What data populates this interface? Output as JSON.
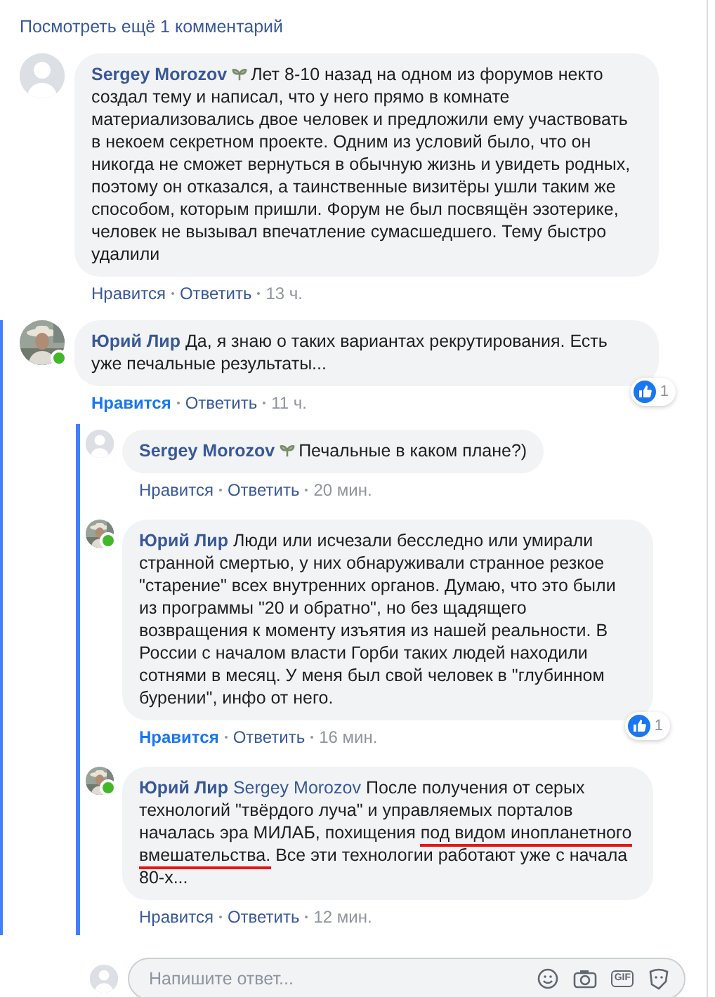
{
  "more_link": "Посмотреть ещё 1 комментарий",
  "comments": [
    {
      "author": "Sergey Morozov",
      "badge": true,
      "photo": false,
      "online": false,
      "segments": [
        {
          "kind": "plain",
          "text": "Лет 8-10 назад на одном из форумов некто создал тему и написал, что у него прямо в комнате материализовались двое человек и предложили ему участвовать в некоем секретном проекте. Одним из условий было, что он никогда не сможет вернуться в обычную жизнь и увидеть родных, поэтому он отказался, а таинственные визитёры ушли таким же способом, которым пришли. Форум не был посвящён эзотерике, человек не вызывал впечатление сумасшедшего. Тему быстро удалили"
        }
      ],
      "like": "Нравится",
      "liked": false,
      "reply": "Ответить",
      "time": "13 ч."
    },
    {
      "author": "Юрий Лир",
      "badge": false,
      "photo": true,
      "online": true,
      "segments": [
        {
          "kind": "plain",
          "text": "Да, я знаю о таких вариантах рекрутирования. Есть уже печальные результаты..."
        }
      ],
      "like": "Нравится",
      "liked": true,
      "reply": "Ответить",
      "time": "11 ч.",
      "reactions": "1",
      "children": [
        {
          "author": "Sergey Morozov",
          "badge": true,
          "photo": false,
          "online": false,
          "segments": [
            {
              "kind": "plain",
              "text": "Печальные в каком плане?)"
            }
          ],
          "like": "Нравится",
          "liked": false,
          "reply": "Ответить",
          "time": "20 мин."
        },
        {
          "author": "Юрий Лир",
          "badge": false,
          "photo": true,
          "online": true,
          "segments": [
            {
              "kind": "plain",
              "text": "Люди или исчезали бесследно или умирали странной смертью, у них обнаруживали странное резкое \"старение\" всех внутренних органов. Думаю, что это были из программы \"20 и обратно\", но без щадящего возвращения к моменту изъятия из нашей реальности. В России с началом власти Горби таких людей находили сотнями в месяц. У меня был свой человек в \"глубинном бурении\", инфо от него."
            }
          ],
          "like": "Нравится",
          "liked": true,
          "reply": "Ответить",
          "time": "16 мин.",
          "reactions": "1"
        },
        {
          "author": "Юрий Лир",
          "badge": false,
          "photo": true,
          "online": true,
          "segments": [
            {
              "kind": "mention",
              "text": "Sergey Morozov"
            },
            {
              "kind": "plain",
              "text": "После получения от серых технологий \"твёрдого луча\" и управляемых порталов началась эра МИЛАБ, похищения "
            },
            {
              "kind": "underlined",
              "text": "под видом инопланетного вмешательства."
            },
            {
              "kind": "plain",
              "text": " Все эти технологии работают уже с начала 80-х..."
            }
          ],
          "like": "Нравится",
          "liked": false,
          "reply": "Ответить",
          "time": "12 мин."
        }
      ]
    }
  ],
  "reply_box": {
    "placeholder": "Напишите ответ...",
    "gif_label": "GIF"
  }
}
